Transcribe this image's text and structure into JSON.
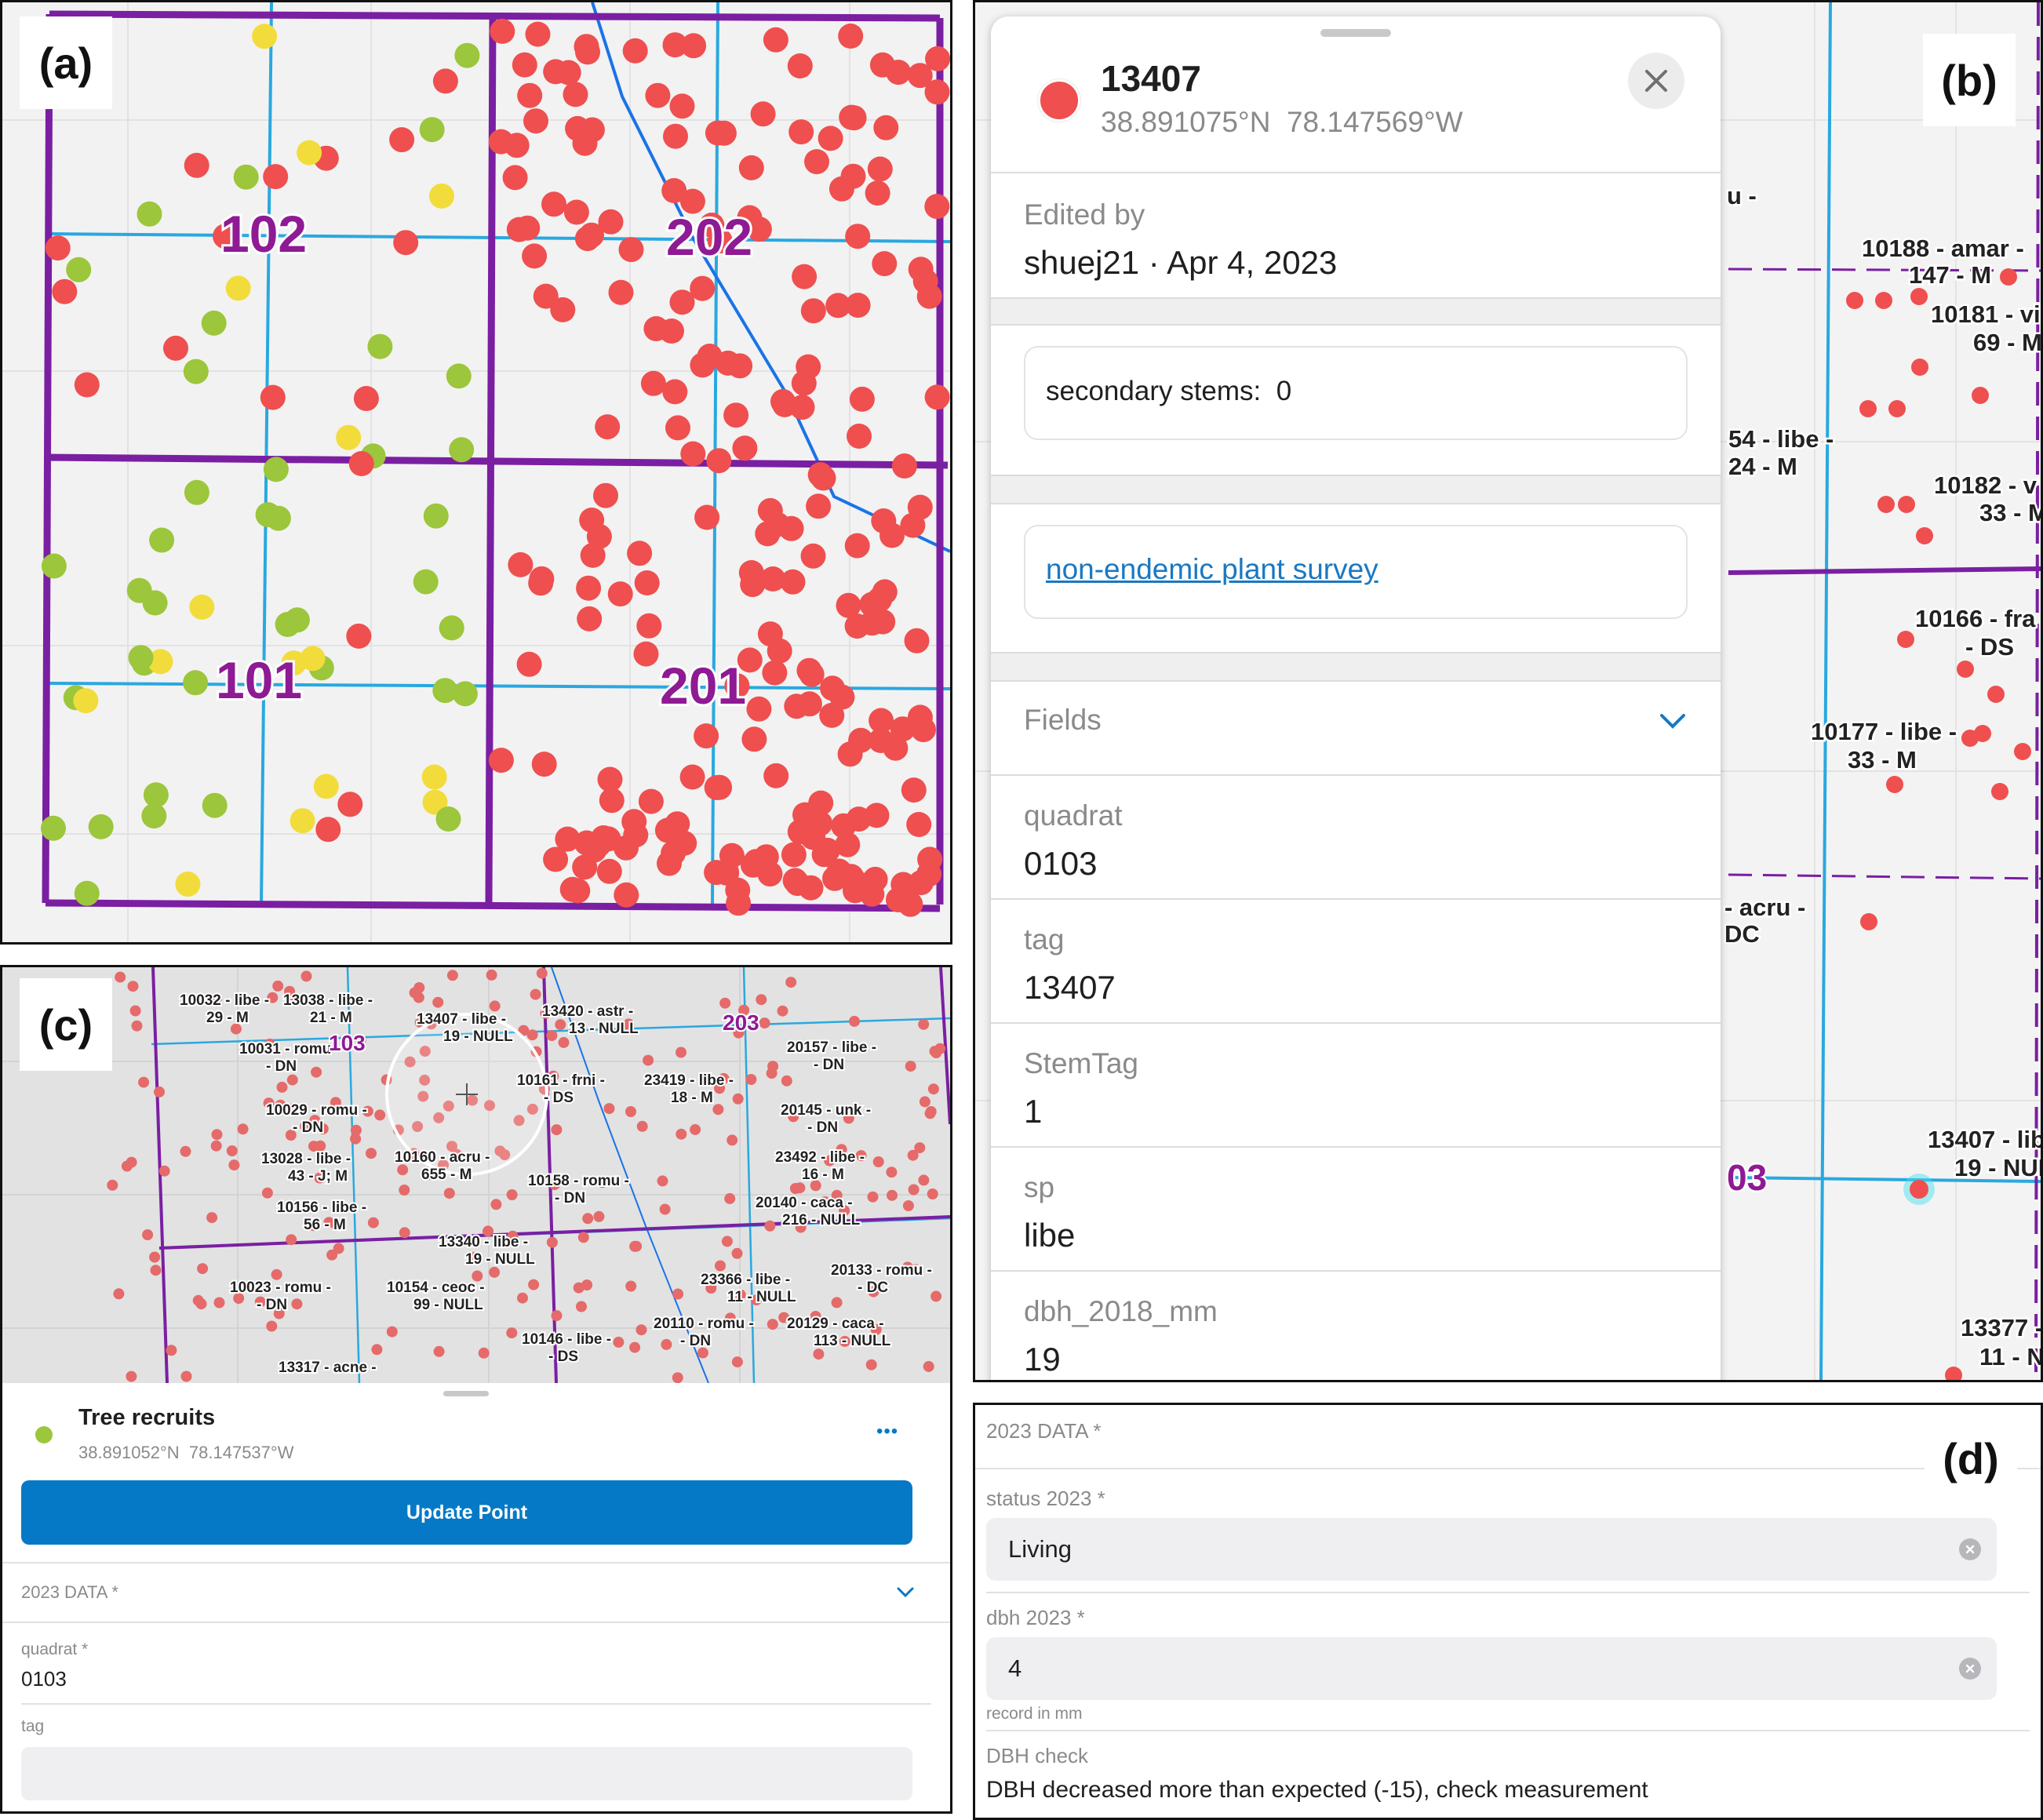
{
  "panel_a": {
    "label": "(a)",
    "quadrat_labels": [
      "102",
      "202",
      "101",
      "201"
    ]
  },
  "panel_b": {
    "label": "(b)",
    "header": {
      "tag": "13407",
      "coords": "38.891075°N  78.147569°W"
    },
    "edited_by_label": "Edited by",
    "edited_by_value": "shuej21 · Apr 4, 2023",
    "secondary_stems": "secondary stems:  0",
    "survey_link": "non-endemic plant survey",
    "fields_label": "Fields",
    "fields": [
      {
        "name": "quadrat",
        "value": "0103"
      },
      {
        "name": "tag",
        "value": "13407"
      },
      {
        "name": "StemTag",
        "value": "1"
      },
      {
        "name": "sp",
        "value": "libe"
      },
      {
        "name": "dbh_2018_mm",
        "value": "19"
      }
    ],
    "map_labels": {
      "l1": "u -",
      "l2a": "10188 - amar -",
      "l2b": "147 - M",
      "l3a": "10181 - vi",
      "l3b": "69 - M",
      "l4a": "54 - libe -",
      "l4b": "24 - M",
      "l5a": "10182 - v",
      "l5b": "33 - M",
      "l6a": "10166 - fra",
      "l6b": "- DS",
      "l7a": "10177 - libe -",
      "l7b": "33 - M",
      "l8a": "- acru -",
      "l8b": "DC",
      "l9": "03",
      "l10a": "13407 - lib",
      "l10b": "19 - NUL",
      "l11a": "13377 -",
      "l11b": "11 - N"
    }
  },
  "panel_c": {
    "label": "(c)",
    "map_labels": [
      [
        "10032 - libe -",
        "29 - M"
      ],
      [
        "13038 - libe -",
        "21 - M"
      ],
      [
        "13407 - libe -",
        "19 - NULL"
      ],
      [
        "13420 - astr -",
        "13 - NULL"
      ],
      [
        "10031 - romu -",
        "- DN"
      ],
      [
        "10161 - frni -",
        "- DS"
      ],
      [
        "23419 - libe -",
        "18 - M"
      ],
      [
        "20157 - libe -",
        "- DN"
      ],
      [
        "10029 - romu -",
        "- DN"
      ],
      [
        "20145 - unk -",
        "- DN"
      ],
      [
        "13028 - libe -",
        "43 - J; M"
      ],
      [
        "10160 - acru -",
        "655 - M"
      ],
      [
        "23492 - libe -",
        "16 - M"
      ],
      [
        "10158 - romu -",
        "- DN"
      ],
      [
        "10156 - libe -",
        "56 - M"
      ],
      [
        "20140 - caca -",
        "216 - NULL"
      ],
      [
        "13340 - libe -",
        "19 - NULL"
      ],
      [
        "20133 - romu -",
        "- DC"
      ],
      [
        "10023 - romu -",
        "- DN"
      ],
      [
        "10154 - ceoc -",
        "99 - NULL"
      ],
      [
        "23366 - libe -",
        "11 - NULL"
      ],
      [
        "20110 - romu -",
        "- DN"
      ],
      [
        "20129 - caca -",
        "113 - NULL"
      ],
      [
        "10146 - libe -",
        "- DS"
      ],
      [
        "13317 - acne -",
        ""
      ]
    ],
    "quadrat_labels": [
      "103",
      "203"
    ],
    "layer_name": "Tree recruits",
    "coords": "38.891052°N  78.147537°W",
    "more": "•••",
    "update_button": "Update Point",
    "section": "2023 DATA *",
    "quadrat_label": "quadrat *",
    "quadrat_value": "0103",
    "tag_label": "tag"
  },
  "panel_d": {
    "label": "(d)",
    "section": "2023 DATA *",
    "status_label": "status 2023 *",
    "status_value": "Living",
    "dbh_label": "dbh 2023 *",
    "dbh_value": "4",
    "dbh_hint": "record in mm",
    "check_label": "DBH check",
    "check_value": "DBH decreased more than expected (-15), check measurement"
  },
  "colors": {
    "quadrat_purple": "#7a1fa2",
    "grid_blue": "#29a8e0",
    "dead_red": "#ef4f4f",
    "living_green": "#9cc63b",
    "yellow": "#f2dc3c",
    "accent_blue": "#0579c5"
  }
}
